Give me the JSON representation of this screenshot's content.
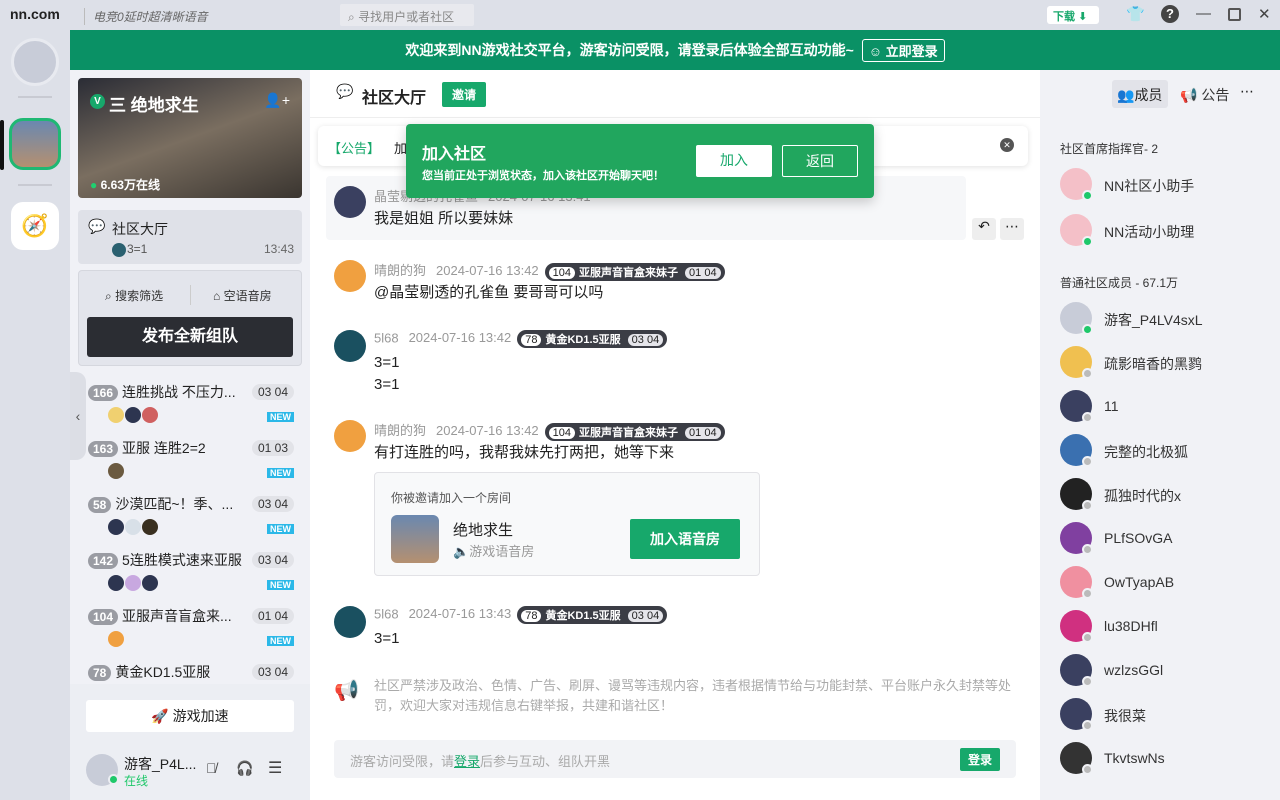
{
  "topbar": {
    "logo": "nn.com",
    "slogan": "电竞0延时超清晰语音",
    "search_placeholder": "寻找用户或者社区",
    "download": "下载"
  },
  "banner": {
    "text": "欢迎来到NN游戏社交平台，游客访问受限，请登录后体验全部互动功能~",
    "login": "立即登录"
  },
  "community": {
    "name": "三 绝地求生",
    "online": "6.63万在线",
    "hall": "社区大厅",
    "hall_sub": "3=1",
    "hall_time": "13:43",
    "search_filter": "搜索筛选",
    "voice_room": "空语音房",
    "publish": "发布全新组队",
    "accelerate": "游戏加速",
    "rooms": [
      {
        "count": "166",
        "title": "连胜挑战 不压力...",
        "cur": "03",
        "max": "04",
        "new": "NEW",
        "colors": [
          "#f0d070",
          "#2d3550",
          "#d06060"
        ]
      },
      {
        "count": "163",
        "title": "亚服 连胜2=2",
        "cur": "01",
        "max": "03",
        "new": "NEW",
        "colors": [
          "#6b5a40"
        ]
      },
      {
        "count": "58",
        "title": "沙漠匹配~！季、...",
        "cur": "03",
        "max": "04",
        "new": "NEW",
        "colors": [
          "#2d3550",
          "#d8e0e8",
          "#3a3020"
        ]
      },
      {
        "count": "142",
        "title": "5连胜模式速来亚服",
        "cur": "03",
        "max": "04",
        "new": "NEW",
        "colors": [
          "#2d3550",
          "#c8a8e0",
          "#2d3550"
        ]
      },
      {
        "count": "104",
        "title": "亚服声音盲盒来...",
        "cur": "01",
        "max": "04",
        "new": "NEW",
        "colors": [
          "#f0a040"
        ]
      },
      {
        "count": "78",
        "title": "黄金KD1.5亚服",
        "cur": "03",
        "max": "04"
      }
    ]
  },
  "user": {
    "name": "游客_P4L...",
    "status": "在线"
  },
  "chat": {
    "title": "社区大厅",
    "invite": "邀请",
    "notice_label": "【公告】",
    "notice_text": "加",
    "messages": [
      {
        "name": "晶莹剔透的孔雀鱼",
        "time": "2024-07-16 13:41",
        "lines": [
          "我是姐姐 所以要妹妹"
        ]
      },
      {
        "name": "晴朗的狗",
        "time": "2024-07-16 13:42",
        "tag": {
          "n": "104",
          "t": "亚服声音盲盒来妹子",
          "c": "01",
          "m": "04"
        },
        "lines": [
          "@晶莹剔透的孔雀鱼 要哥哥可以吗"
        ]
      },
      {
        "name": "5l68",
        "time": "2024-07-16 13:42",
        "tag": {
          "n": "78",
          "t": "黄金KD1.5亚服",
          "c": "03",
          "m": "04"
        },
        "lines": [
          "3=1",
          "3=1"
        ]
      },
      {
        "name": "晴朗的狗",
        "time": "2024-07-16 13:42",
        "tag": {
          "n": "104",
          "t": "亚服声音盲盒来妹子",
          "c": "01",
          "m": "04"
        },
        "lines": [
          "有打连胜的吗，我帮我妹先打两把，她等下来"
        ]
      },
      {
        "name": "5l68",
        "time": "2024-07-16 13:43",
        "tag": {
          "n": "78",
          "t": "黄金KD1.5亚服",
          "c": "03",
          "m": "04"
        },
        "lines": [
          "3=1"
        ]
      }
    ],
    "invite_card": {
      "head": "你被邀请加入一个房间",
      "game": "绝地求生",
      "type": "游戏语音房",
      "join": "加入语音房"
    },
    "rules": "社区严禁涉及政治、色情、广告、刷屏、谩骂等违规内容，违者根据情节给与功能封禁、平台账户永久封禁等处罚，欢迎大家对违规信息右键举报，共建和谐社区！",
    "input_pre": "游客访问受限，请",
    "input_link": "登录",
    "input_post": "后参与互动、组队开黑",
    "login": "登录"
  },
  "popup": {
    "title": "加入社区",
    "desc": "您当前正处于浏览状态，加入该社区开始聊天吧！",
    "join": "加入",
    "back": "返回"
  },
  "members": {
    "tab_members": "成员",
    "tab_notice": "公告",
    "admin_header": "社区首席指挥官- 2",
    "normal_header": "普通社区成员 - 67.1万",
    "admins": [
      {
        "name": "NN社区小助手"
      },
      {
        "name": "NN活动小助理"
      }
    ],
    "normal": [
      {
        "name": "游客_P4LV4sxL",
        "online": true
      },
      {
        "name": "疏影暗香的黑鹨"
      },
      {
        "name": "11"
      },
      {
        "name": "完整的北极狐"
      },
      {
        "name": "孤独时代的x"
      },
      {
        "name": "PLfSOvGA"
      },
      {
        "name": "OwTyapAB"
      },
      {
        "name": "lu38DHfl"
      },
      {
        "name": "wzlzsGGl"
      },
      {
        "name": "我很菜"
      },
      {
        "name": "TkvtswNs"
      }
    ]
  },
  "colors": {
    "brand": "#0a9165",
    "accent": "#17a86b",
    "popup": "#21a65e"
  }
}
